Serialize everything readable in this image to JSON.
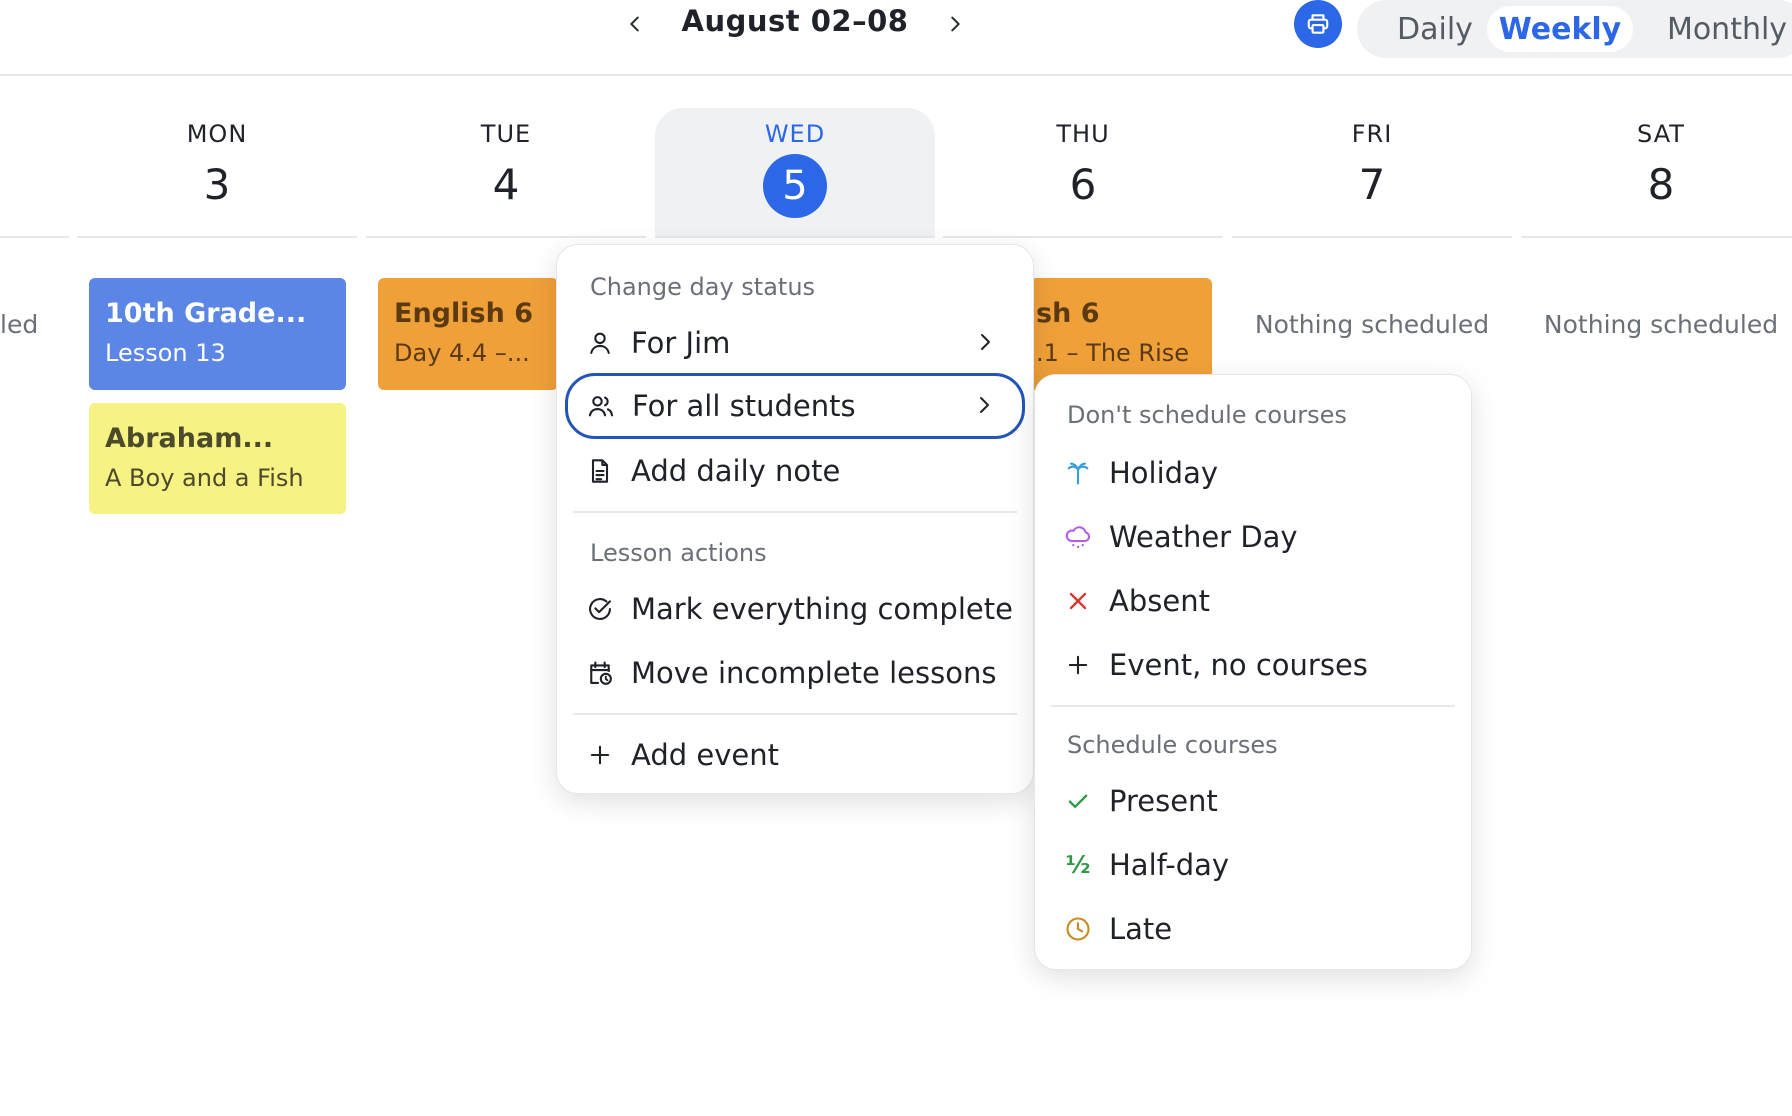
{
  "header": {
    "date_range": "August 02–08",
    "views": {
      "daily": "Daily",
      "weekly": "Weekly",
      "monthly": "Monthly"
    },
    "active_view": "Weekly",
    "accent_color": "#2c67e8"
  },
  "days": [
    {
      "name": "MON",
      "num": "3"
    },
    {
      "name": "TUE",
      "num": "4"
    },
    {
      "name": "WED",
      "num": "5",
      "today": true
    },
    {
      "name": "THU",
      "num": "6"
    },
    {
      "name": "FRI",
      "num": "7"
    },
    {
      "name": "SAT",
      "num": "8"
    }
  ],
  "schedule": {
    "partial_prev_text": "led",
    "mon": [
      {
        "title": "10th Grade...",
        "subtitle": "Lesson 13",
        "color": "#5b86e6"
      },
      {
        "title": "Abraham...",
        "subtitle": "A Boy and a Fish",
        "color": "#f6f283"
      }
    ],
    "tue": [
      {
        "title": "English 6",
        "subtitle": "Day 4.4 –...",
        "color": "#f0a039"
      }
    ],
    "thu": [
      {
        "title": "sh 6",
        "subtitle": ".1 – The Rise ...",
        "color": "#f0a039"
      }
    ],
    "fri_empty": "Nothing scheduled",
    "sat_empty": "Nothing scheduled"
  },
  "day_menu": {
    "section_status": "Change day status",
    "for_jim": "For Jim",
    "for_all_students": "For all students",
    "add_daily_note": "Add daily note",
    "section_lessons": "Lesson actions",
    "mark_complete": "Mark everything complete",
    "move_incomplete": "Move incomplete lessons",
    "add_event": "Add event"
  },
  "status_menu": {
    "section_no_courses": "Don't schedule courses",
    "holiday": "Holiday",
    "weather_day": "Weather Day",
    "absent": "Absent",
    "event_no_courses": "Event, no courses",
    "section_courses": "Schedule courses",
    "present": "Present",
    "half_day": "Half-day",
    "half_glyph": "½",
    "late": "Late"
  },
  "icons": [
    "chevron-left-icon",
    "chevron-right-icon",
    "printer-icon",
    "person-icon",
    "people-icon",
    "document-icon",
    "check-circle-icon",
    "calendar-clock-icon",
    "plus-icon",
    "palm-tree-icon",
    "cloud-snow-icon",
    "x-icon",
    "check-icon",
    "clock-icon"
  ]
}
